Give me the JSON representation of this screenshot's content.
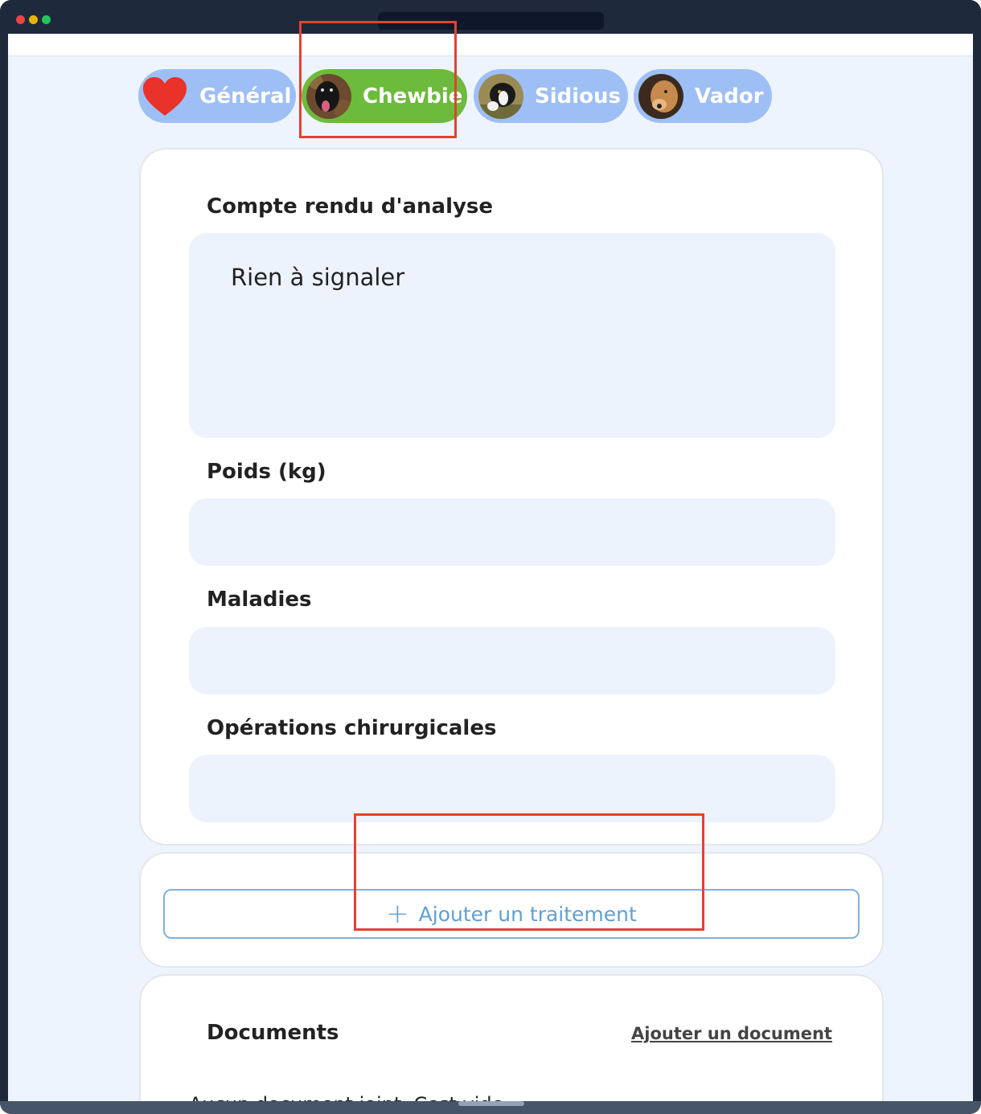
{
  "tabs": [
    {
      "label": "Général",
      "icon": "heart-icon",
      "active": false
    },
    {
      "label": "Chewbie",
      "icon": "dog-avatar",
      "active": true
    },
    {
      "label": "Sidious",
      "icon": "dog-avatar",
      "active": false
    },
    {
      "label": "Vador",
      "icon": "dog-avatar",
      "active": false
    }
  ],
  "form": {
    "analysis_label": "Compte rendu d'analyse",
    "analysis_value": "Rien à signaler",
    "weight_label": "Poids (kg)",
    "weight_value": "",
    "diseases_label": "Maladies",
    "diseases_value": "",
    "surgery_label": "Opérations chirurgicales",
    "surgery_value": ""
  },
  "treatment": {
    "add_label": "Ajouter un traitement"
  },
  "documents": {
    "title": "Documents",
    "add_link": "Ajouter un document",
    "empty_text": "Aucun document joint. Cest vide."
  },
  "colors": {
    "tab_inactive": "#9dbff5",
    "tab_active": "#6cbb3c",
    "accent_blue": "#5fa0d4",
    "highlight": "#e5412f",
    "page_bg": "#eef4fd"
  }
}
